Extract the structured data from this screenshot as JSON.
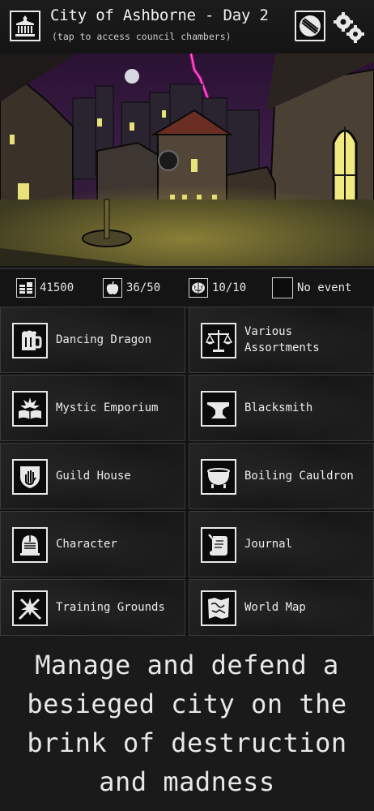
{
  "header": {
    "title": "City of Ashborne - Day 2",
    "subtitle": "(tap to access council chambers)",
    "icons": {
      "city": "city-hall-icon",
      "stats": "shield-emblem-icon",
      "settings": "gear-icon"
    }
  },
  "status": {
    "gold": {
      "value": "41500",
      "icon": "coins-icon"
    },
    "food": {
      "value": "36/50",
      "icon": "apple-icon"
    },
    "sanity": {
      "value": "10/10",
      "icon": "brain-icon"
    },
    "event": {
      "value": "No event",
      "icon": "empty-box-icon"
    }
  },
  "locations": [
    {
      "label": "Dancing Dragon",
      "icon": "beer-mug-icon"
    },
    {
      "label": "Various Assortments",
      "icon": "scales-icon"
    },
    {
      "label": "Mystic Emporium",
      "icon": "spellbook-icon"
    },
    {
      "label": "Blacksmith",
      "icon": "anvil-icon"
    },
    {
      "label": "Guild House",
      "icon": "hand-shield-icon"
    },
    {
      "label": "Boiling Cauldron",
      "icon": "cauldron-icon"
    },
    {
      "label": "Character",
      "icon": "knight-helmet-icon"
    },
    {
      "label": "Journal",
      "icon": "scroll-quill-icon"
    },
    {
      "label": "Training Grounds",
      "icon": "crossed-swords-icon"
    },
    {
      "label": "World Map",
      "icon": "map-icon"
    }
  ],
  "tagline": {
    "line1": "Manage and defend a",
    "line2": "besieged city on the",
    "line3": "brink of destruction",
    "line4": "and madness"
  }
}
